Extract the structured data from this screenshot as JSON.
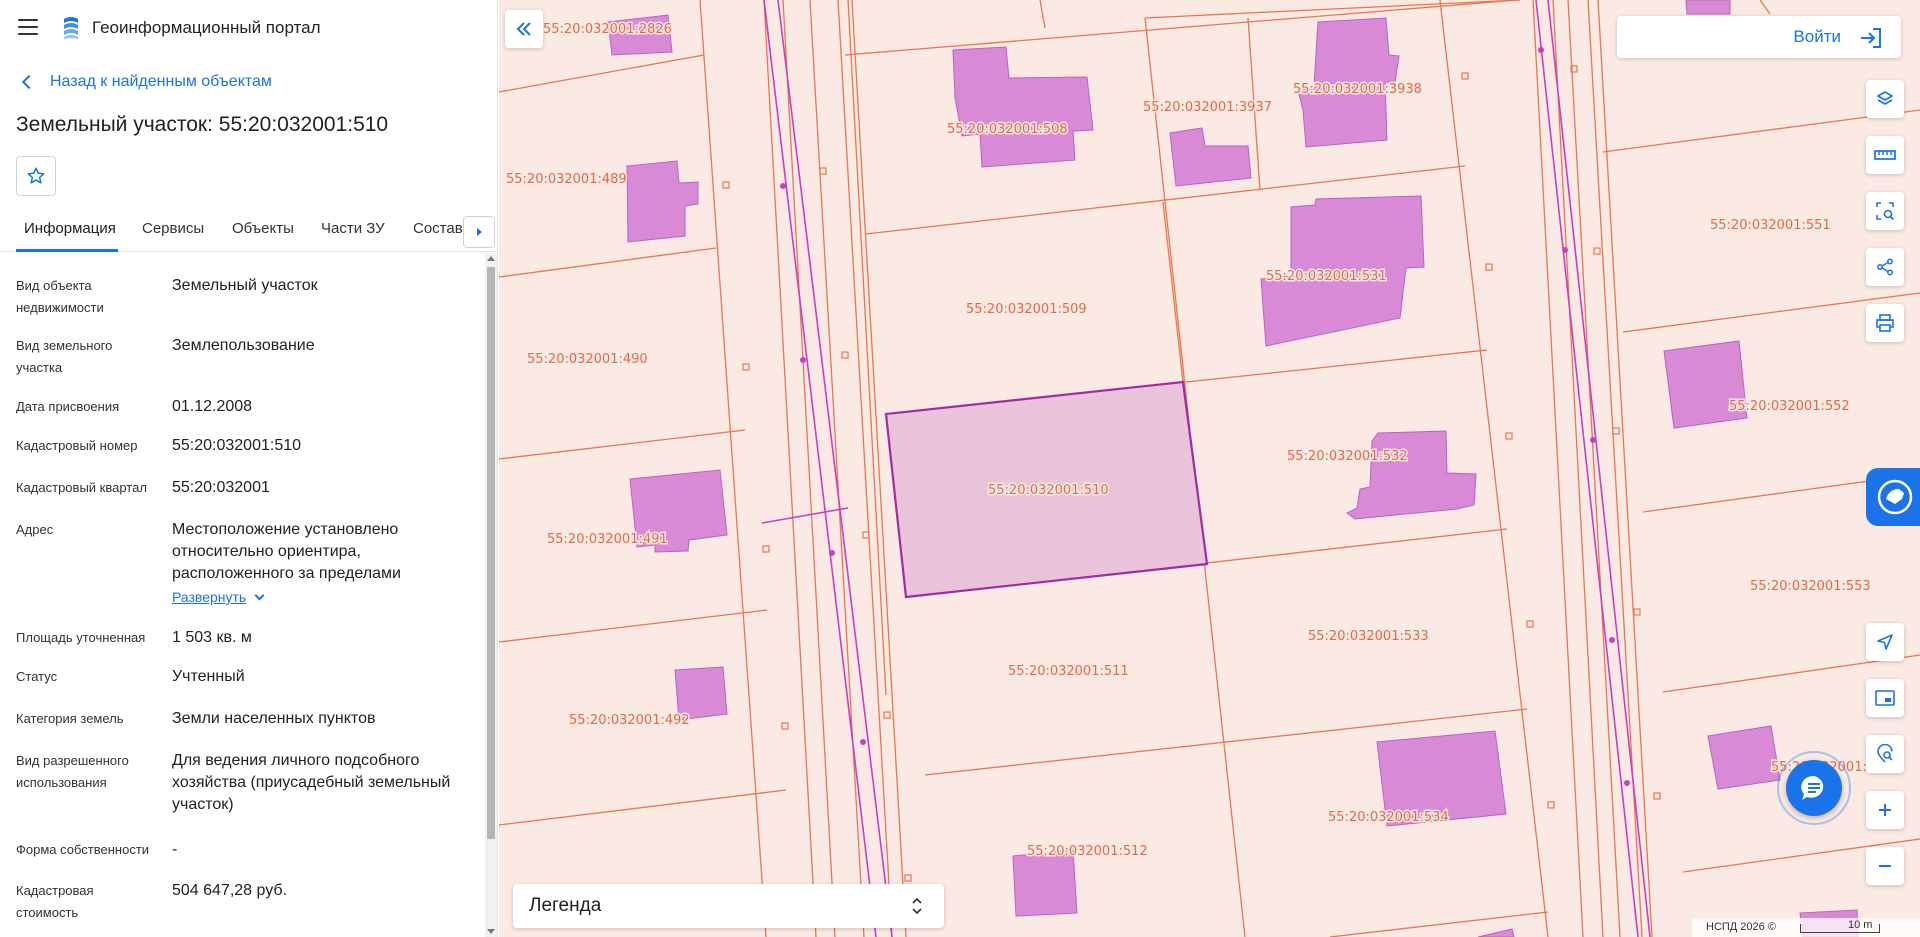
{
  "header": {
    "portal_title": "Геоинформационный портал"
  },
  "nav": {
    "back_label": "Назад к найденным объектам"
  },
  "object": {
    "title": "Земельный участок: 55:20:032001:510"
  },
  "tabs": [
    {
      "label": "Информация"
    },
    {
      "label": "Сервисы"
    },
    {
      "label": "Объекты"
    },
    {
      "label": "Части ЗУ"
    },
    {
      "label": "Состав"
    }
  ],
  "info": [
    {
      "label": "Вид объекта недвижимости",
      "value": "Земельный участок"
    },
    {
      "label": "Вид земельного участка",
      "value": "Землепользование"
    },
    {
      "label": "Дата присвоения",
      "value": "01.12.2008"
    },
    {
      "label": "Кадастровый номер",
      "value": "55:20:032001:510"
    },
    {
      "label": "Кадастровый квартал",
      "value": "55:20:032001"
    },
    {
      "label": "Адрес",
      "value": "Местоположение установлено относительно ориентира, расположенного за пределами",
      "expand_label": "Развернуть"
    },
    {
      "label": "Площадь уточненная",
      "value": "1 503 кв. м"
    },
    {
      "label": "Статус",
      "value": "Учтенный"
    },
    {
      "label": "Категория земель",
      "value": "Земли населенных пунктов"
    },
    {
      "label": "Вид разрешенного использования",
      "value": "Для ведения личного подсобного хозяйства (приусадебный земельный участок)"
    },
    {
      "label": "Форма собственности",
      "value": "-"
    },
    {
      "label": "Кадастровая стоимость",
      "value": "504 647,28 руб."
    }
  ],
  "map": {
    "parcel_labels": [
      "55:20:032001:2826",
      "55:20:032001:508",
      "55:20:032001:3937",
      "55:20:032001:3938",
      "55:20:032001:489",
      "55:20:032001:531",
      "55:20:032001:551",
      "55:20:032001:509",
      "55:20:032001:490",
      "55:20:032001:552",
      "55:20:032001:510",
      "55:20:032001:532",
      "55:20:032001:491",
      "55:20:032001:553",
      "55:20:032001:533",
      "55:20:032001:511",
      "55:20:032001:492",
      "55:20:032001:534",
      "55:20:032001:512",
      "55:20:032001:"
    ],
    "login_label": "Войти",
    "legend_label": "Легенда",
    "copyright": "НСПД 2026 ©",
    "scale_label": "10 m",
    "colors": {
      "parcel_line": "#e9764f",
      "building": "#d98ad6",
      "selected": "#a22aa8",
      "accent": "#1a73e8",
      "background": "#fbe9e3"
    }
  }
}
